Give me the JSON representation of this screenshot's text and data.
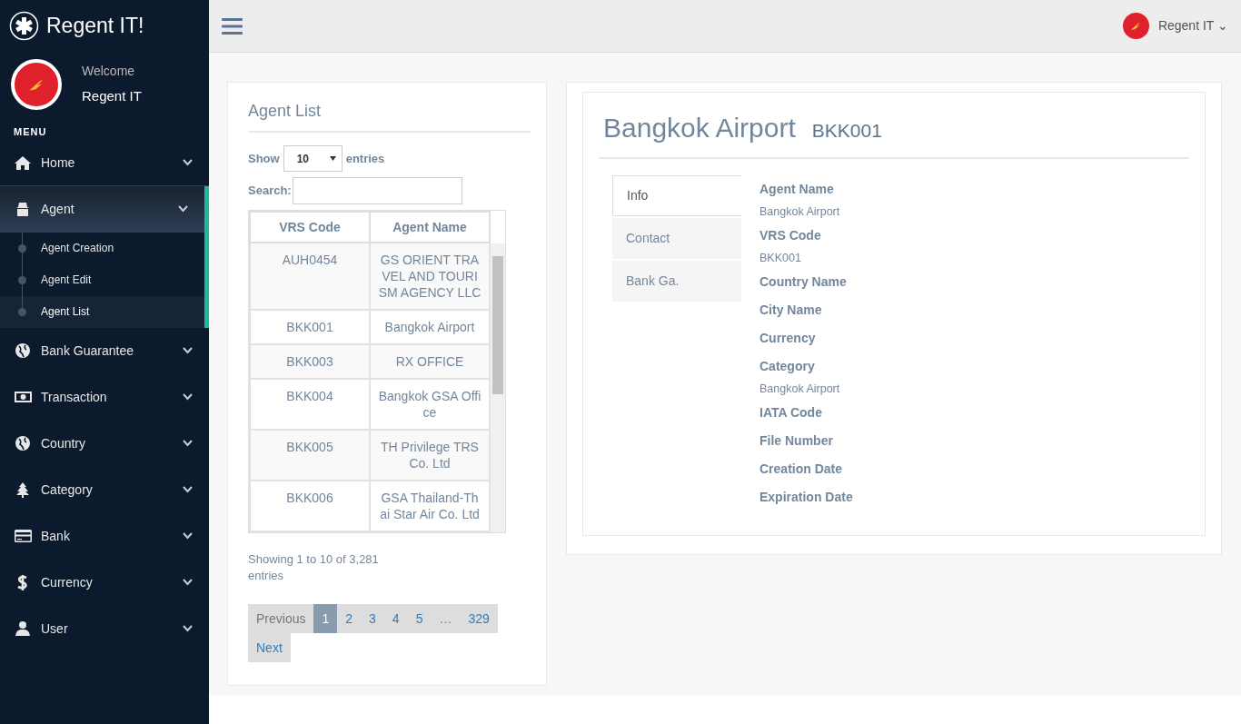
{
  "brand": {
    "title": "Regent IT!"
  },
  "profile": {
    "greeting": "Welcome",
    "name": "Regent IT"
  },
  "menu_heading": "MENU",
  "sidebar": {
    "items": [
      {
        "label": "Home",
        "selected": false
      },
      {
        "label": "Agent",
        "selected": true,
        "children": [
          {
            "label": "Agent Creation",
            "selected": false
          },
          {
            "label": "Agent Edit",
            "selected": false
          },
          {
            "label": "Agent List",
            "selected": true
          }
        ]
      },
      {
        "label": "Bank Guarantee",
        "selected": false
      },
      {
        "label": "Transaction",
        "selected": false
      },
      {
        "label": "Country",
        "selected": false
      },
      {
        "label": "Category",
        "selected": false
      },
      {
        "label": "Bank",
        "selected": false
      },
      {
        "label": "Currency",
        "selected": false
      },
      {
        "label": "User",
        "selected": false
      }
    ]
  },
  "topbar": {
    "user": "Regent IT",
    "caret": "⌄"
  },
  "agent_list": {
    "title": "Agent List",
    "show_label": "Show",
    "page_size": "10",
    "entries_label": "entries",
    "search_label": "Search:",
    "table": {
      "columns": [
        "VRS Code",
        "Agent Name"
      ],
      "rows": [
        [
          "AUH0454",
          "GS ORIENT TRAVEL AND TOURISM AGENCY LLC"
        ],
        [
          "BKK001",
          "Bangkok Airport"
        ],
        [
          "BKK003",
          "RX OFFICE"
        ],
        [
          "BKK004",
          "Bangkok GSA Office"
        ],
        [
          "BKK005",
          "TH Privilege TRS Co. Ltd"
        ],
        [
          "BKK006",
          "GSA Thailand-Thai Star Air Co. Ltd"
        ]
      ]
    },
    "info": "Showing 1 to 10 of 3,281 entries",
    "pagination": [
      {
        "label": "Previous",
        "selected": false,
        "disabled": true
      },
      {
        "label": "1",
        "selected": true,
        "disabled": false
      },
      {
        "label": "2",
        "selected": false,
        "disabled": false
      },
      {
        "label": "3",
        "selected": false,
        "disabled": false
      },
      {
        "label": "4",
        "selected": false,
        "disabled": false
      },
      {
        "label": "5",
        "selected": false,
        "disabled": false
      },
      {
        "label": "…",
        "selected": false,
        "disabled": true
      },
      {
        "label": "329",
        "selected": false,
        "disabled": false
      },
      {
        "label": "Next",
        "selected": false,
        "disabled": false
      }
    ]
  },
  "detail": {
    "title": "Bangkok Airport",
    "code": "BKK001",
    "tabs": [
      {
        "label": "Info",
        "selected": true
      },
      {
        "label": "Contact",
        "selected": false
      },
      {
        "label": "Bank Ga.",
        "selected": false
      }
    ],
    "fields": [
      {
        "label": "Agent Name",
        "value": "Bangkok Airport"
      },
      {
        "label": "VRS Code",
        "value": "BKK001"
      },
      {
        "label": "Country Name"
      },
      {
        "label": "City Name"
      },
      {
        "label": "Currency"
      },
      {
        "label": "Category",
        "value": "Bangkok Airport"
      },
      {
        "label": "IATA Code"
      },
      {
        "label": "File Number"
      },
      {
        "label": "Creation Date"
      },
      {
        "label": "Expiration Date"
      }
    ]
  }
}
